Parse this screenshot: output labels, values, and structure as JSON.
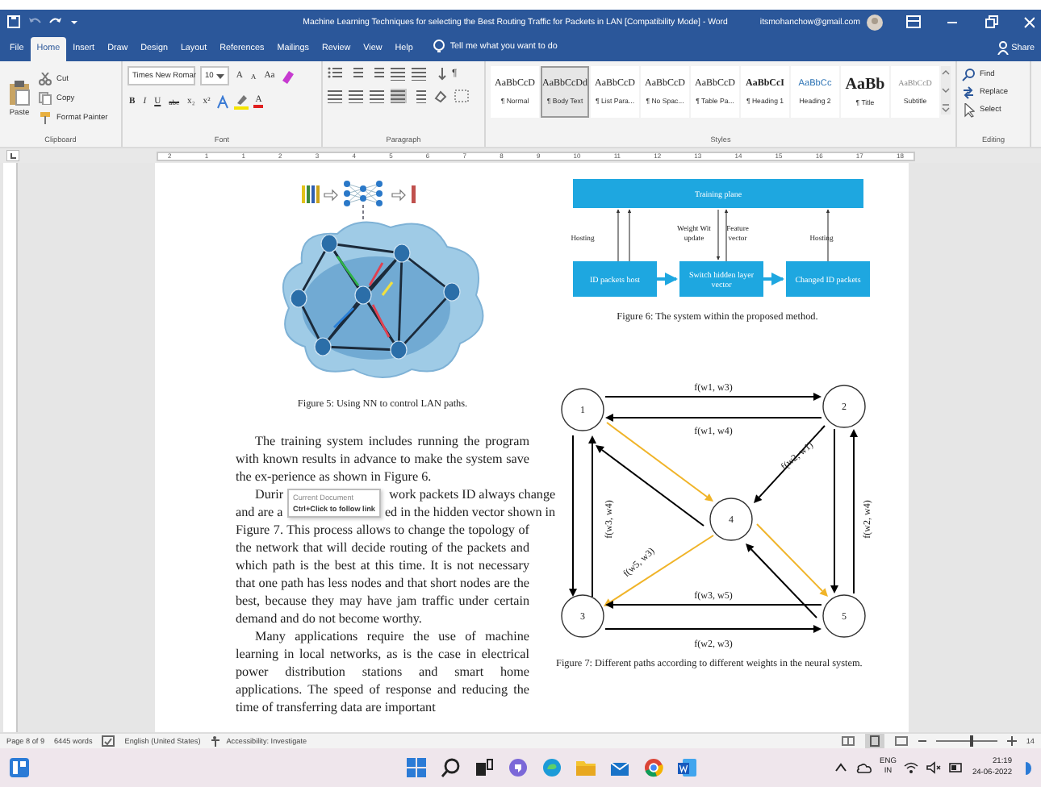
{
  "title_bar": {
    "title": "Machine Learning Techniques for selecting the Best Routing Traffic for Packets in LAN [Compatibility Mode] - Word",
    "account": "itsmohanchow@gmail.com"
  },
  "ribbon_tabs": [
    {
      "label": "File",
      "selected": false
    },
    {
      "label": "Home",
      "selected": true
    },
    {
      "label": "Insert",
      "selected": false
    },
    {
      "label": "Draw",
      "selected": false
    },
    {
      "label": "Design",
      "selected": false
    },
    {
      "label": "Layout",
      "selected": false
    },
    {
      "label": "References",
      "selected": false
    },
    {
      "label": "Mailings",
      "selected": false
    },
    {
      "label": "Review",
      "selected": false
    },
    {
      "label": "View",
      "selected": false
    },
    {
      "label": "Help",
      "selected": false
    }
  ],
  "tell_me": "Tell me what you want to do",
  "share": "Share",
  "clipboard": {
    "paste": "Paste",
    "cut": "Cut",
    "copy": "Copy",
    "format_painter": "Format Painter",
    "group": "Clipboard"
  },
  "font": {
    "name": "Times New Romar",
    "size": "10",
    "buttons_top": [
      "A",
      "A",
      "Aa"
    ],
    "buttons_bottom": [
      "B",
      "I",
      "U",
      "abc",
      "x₂",
      "x²"
    ],
    "font_color": "A",
    "group": "Font"
  },
  "paragraph": {
    "pilcrow": "¶",
    "group": "Paragraph"
  },
  "styles": {
    "group": "Styles",
    "items": [
      {
        "preview": "AaBbCcD",
        "name": "¶ Normal",
        "kind": "normal",
        "selected": false
      },
      {
        "preview": "AaBbCcDd",
        "name": "¶ Body Text",
        "kind": "normal",
        "selected": true
      },
      {
        "preview": "AaBbCcD",
        "name": "¶ List Para...",
        "kind": "normal",
        "selected": false
      },
      {
        "preview": "AaBbCcD",
        "name": "¶ No Spac...",
        "kind": "normal",
        "selected": false
      },
      {
        "preview": "AaBbCcD",
        "name": "¶ Table Pa...",
        "kind": "normal",
        "selected": false
      },
      {
        "preview": "AaBbCcI",
        "name": "¶ Heading 1",
        "kind": "heading1",
        "selected": false
      },
      {
        "preview": "AaBbCc",
        "name": "Heading 2",
        "kind": "heading2",
        "selected": false
      },
      {
        "preview": "AaBb",
        "name": "¶ Title",
        "kind": "title",
        "selected": false
      },
      {
        "preview": "AaBbCcD",
        "name": "Subtitle",
        "kind": "subtitle",
        "selected": false
      }
    ]
  },
  "editing": {
    "group": "Editing",
    "items": [
      "Find",
      "Replace",
      "Select"
    ]
  },
  "ruler": [
    "2",
    "1",
    "1",
    "2",
    "3",
    "4",
    "5",
    "6",
    "7",
    "8",
    "9",
    "10",
    "11",
    "12",
    "13",
    "14",
    "15",
    "16",
    "17",
    "18"
  ],
  "document": {
    "figure5": {
      "caption": "Figure 5: Using NN to control LAN paths."
    },
    "paragraphs": [
      {
        "kind": "plain",
        "text": "The training system includes running the program with known results in advance to make the system save the ex-perience as shown in Figure 6."
      },
      {
        "kind": "tooltip",
        "line1_start": "Durir",
        "line1_end": "work packets ID always change",
        "line2_start": "and are a",
        "line2_end": "ed in the hidden vector shown in",
        "tip_title": "Current Document",
        "tip_hint": "Ctrl+Click to follow link",
        "rest": "Figure 7. This process allows to change the topology of the network that will decide routing of the packets and which path is the best at this time. It is not necessary that one path has less nodes and that short nodes are the best, because they may have jam traffic under certain demand and do not become worthy."
      },
      {
        "kind": "plain",
        "text": "Many applications require the use of machine learning in local networks, as is the case in electrical power distribution stations and smart home applications. The speed of response and reducing the time of transferring data are important"
      }
    ],
    "figure6": {
      "boxes": [
        "Training plane",
        "ID packets host",
        "Switch hidden layer vector",
        "Changed ID packets"
      ],
      "labels": [
        "Hosting",
        "Weight Wit update",
        "Feature vector",
        "Hosting"
      ],
      "caption": "Figure 6: The system within the proposed method."
    },
    "figure7": {
      "nodes": [
        "1",
        "2",
        "3",
        "4",
        "5"
      ],
      "edges": [
        {
          "color": "#000000",
          "label": "f(w1, w3)"
        },
        {
          "color": "#000000",
          "label": "f(w1, w4)"
        },
        {
          "color": "#000000",
          "label": "f(w2, w1)"
        },
        {
          "color": "#f0b429"
        },
        {
          "color": "#000000"
        },
        {
          "color": "#000000",
          "label": "f(w3, w4)"
        },
        {
          "color": "#000000"
        },
        {
          "color": "#000000",
          "label": "f(w2, w4)"
        },
        {
          "color": "#000000"
        },
        {
          "color": "#f0b429",
          "label": "f(w5, w3)"
        },
        {
          "color": "#f0b429"
        },
        {
          "color": "#000000"
        },
        {
          "color": "#000000",
          "label": "f(w3, w5)"
        },
        {
          "color": "#000000",
          "label": "f(w2, w3)"
        }
      ],
      "caption": "Figure 7: Different paths according to different weights in the neural system."
    }
  },
  "status_bar": {
    "page": "Page 8 of 9",
    "words": "6445 words",
    "language": "English (United States)",
    "accessibility": "Accessibility: Investigate",
    "zoom_slider": {
      "level": 0.55
    },
    "zoom": "14"
  },
  "taskbar": {
    "language": "ENG",
    "region": "IN",
    "time": "21:19",
    "date": "24-06-2022"
  }
}
